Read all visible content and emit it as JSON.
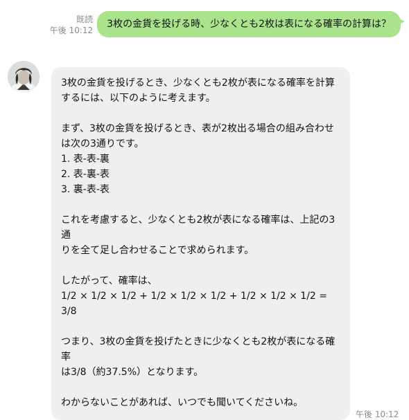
{
  "sent": {
    "read_label": "既読",
    "time": "午後 10:12",
    "text": "3枚の金貨を投げる時、少なくとも2枚は表になる確率の計算は？"
  },
  "received": {
    "time": "午後 10:12",
    "paragraphs": [
      "3枚の金貨を投げるとき、少なくとも2枚が表になる確率を計算\nするには、以下のように考えます。",
      "まず、3枚の金貨を投げるとき、表が2枚出る場合の組み合わせ\nは次の3通りです。\n1. 表-表-裏\n2. 表-裏-表\n3. 裏-表-表",
      "これを考慮すると、少なくとも2枚が表になる確率は、上記の3通\nりを全て足し合わせることで求められます。",
      "したがって、確率は、\n1/2 × 1/2 × 1/2 + 1/2 × 1/2 × 1/2 + 1/2 × 1/2 × 1/2 =\n3/8",
      "つまり、3枚の金貨を投げたときに少なくとも2枚が表になる確率\nは3/8（約37.5%）となります。",
      "わからないことがあれば、いつでも聞いてくださいね。"
    ]
  },
  "colors": {
    "sent_bubble": "#a9e38b",
    "received_bubble": "#efefef",
    "meta_text": "#8a8a8a"
  },
  "icons": {
    "avatar": "contact-avatar"
  }
}
